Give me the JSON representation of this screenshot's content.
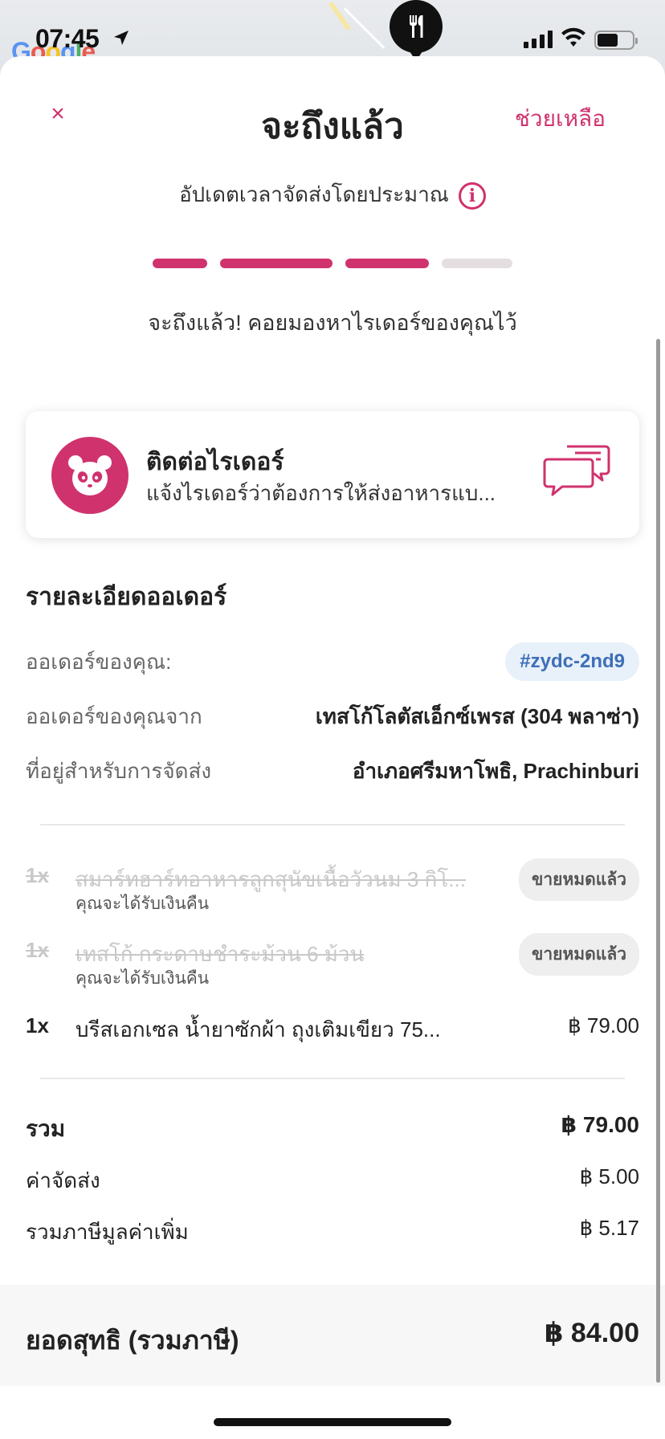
{
  "status_bar": {
    "time": "07:45"
  },
  "map": {
    "watermark": "Google"
  },
  "header": {
    "title": "จะถึงแล้ว",
    "help": "ช่วยเหลือ",
    "close_glyph": "×"
  },
  "eta": {
    "label": "อัปเดตเวลาจัดส่งโดยประมาณ",
    "info_glyph": "i"
  },
  "progress": {
    "completed_steps": 3,
    "total_steps": 4
  },
  "status_message": "จะถึงแล้ว! คอยมองหาไรเดอร์ของคุณไว้",
  "rider_card": {
    "title": "ติดต่อไรเดอร์",
    "subtitle": "แจ้งไรเดอร์ว่าต้องการให้ส่งอาหารแบ...",
    "icon": "chat-bubbles-icon"
  },
  "order_details": {
    "title": "รายละเอียดออเดอร์",
    "order_label": "ออเดอร์ของคุณ:",
    "order_id": "#zydc-2nd9",
    "from_label": "ออเดอร์ของคุณจาก",
    "from_value": "เทสโก้โลตัสเอ็กซ์เพรส (304 พลาซ่า)",
    "address_label": "ที่อยู่สำหรับการจัดส่ง",
    "address_value": "อำเภอศรีมหาโพธิ, Prachinburi"
  },
  "items": [
    {
      "qty": "1x",
      "name": "สมาร์ทฮาร์ทอาหารลูกสุนัขเนื้อวัวนม 3 กิโ...",
      "note": "คุณจะได้รับเงินคืน",
      "badge": "ขายหมดแล้ว",
      "sold_out": true
    },
    {
      "qty": "1x",
      "name": "เทสโก้ กระดาษชำระม้วน 6 ม้วน",
      "note": "คุณจะได้รับเงินคืน",
      "badge": "ขายหมดแล้ว",
      "sold_out": true
    },
    {
      "qty": "1x",
      "name": "บรีสเอกเซล น้ำยาซักผ้า ถุงเติมเขียว 75...",
      "price": "฿ 79.00",
      "sold_out": false
    }
  ],
  "summary": {
    "subtotal_label": "รวม",
    "subtotal_value": "฿ 79.00",
    "delivery_label": "ค่าจัดส่ง",
    "delivery_value": "฿ 5.00",
    "vat_label": "รวมภาษีมูลค่าเพิ่ม",
    "vat_value": "฿ 5.17"
  },
  "total": {
    "label": "ยอดสุทธิ (รวมภาษี)",
    "value": "฿ 84.00"
  },
  "colors": {
    "brand": "#d0326e",
    "order_id_bg": "#e8f0fa",
    "order_id_text": "#3d6fb8"
  }
}
